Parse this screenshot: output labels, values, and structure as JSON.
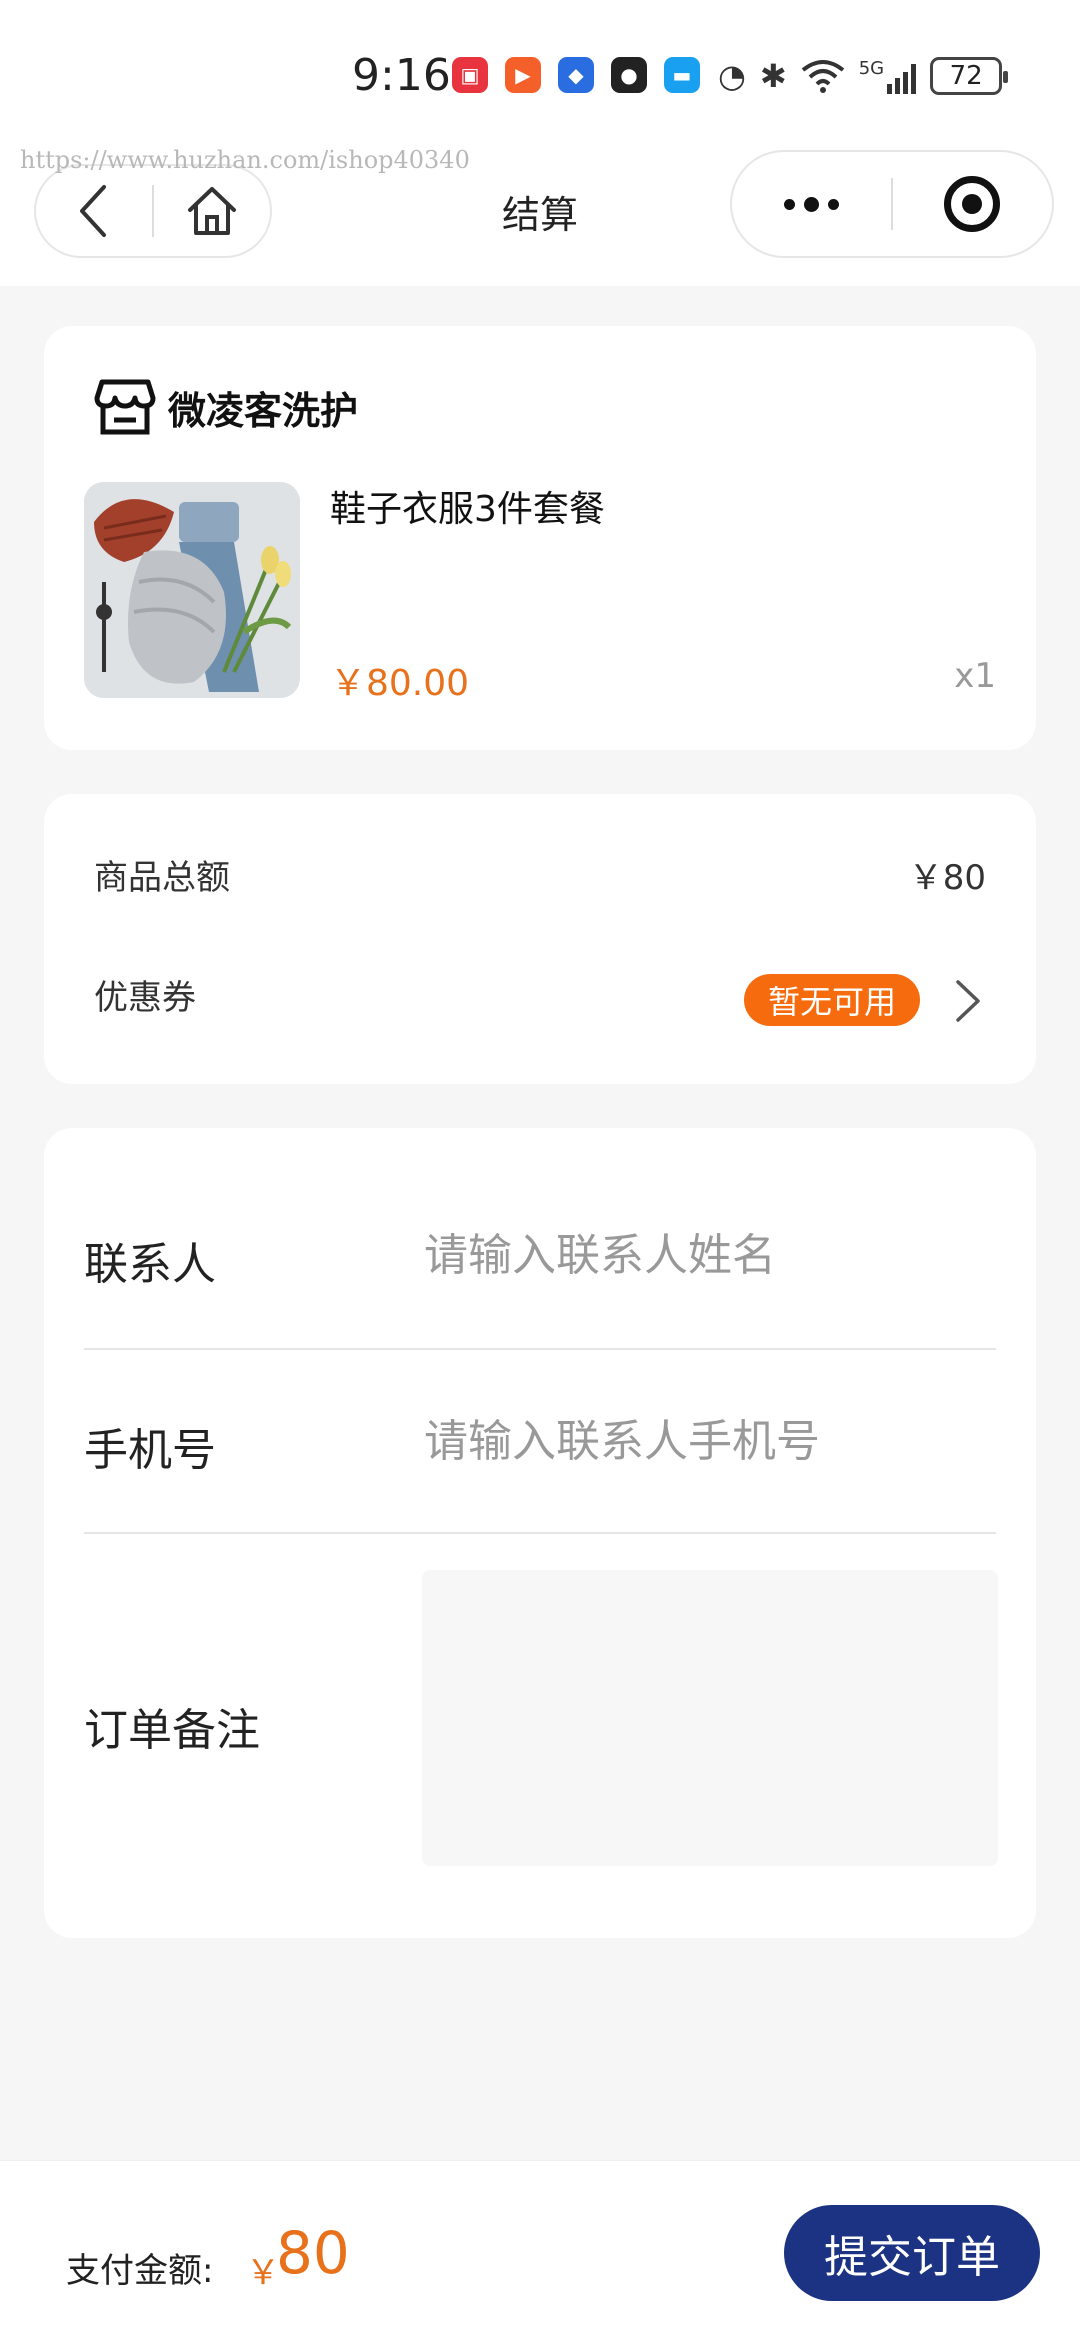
{
  "status_bar": {
    "time": "9:16",
    "network": "5G",
    "battery": "72",
    "apps": [
      {
        "name": "huawei-appgallery-icon",
        "color": "#e8343f",
        "glyph": "▣"
      },
      {
        "name": "kuaishou-icon",
        "color": "#f5602a",
        "glyph": "▶"
      },
      {
        "name": "app-blue-icon",
        "color": "#2a6de0",
        "glyph": "◆"
      },
      {
        "name": "qq-penguin-icon",
        "color": "#222222",
        "glyph": "●"
      },
      {
        "name": "message-bubble-icon",
        "color": "#1aa0f0",
        "glyph": "▬"
      }
    ]
  },
  "watermark": "https://www.huzhan.com/ishop40340",
  "nav": {
    "title": "结算"
  },
  "shop": {
    "name": "微凌客洗护"
  },
  "product": {
    "name": "鞋子衣服3件套餐",
    "price": "￥80.00",
    "qty": "x1"
  },
  "summary": {
    "total_label": "商品总额",
    "total_value": "￥80",
    "coupon_label": "优惠券",
    "coupon_badge": "暂无可用"
  },
  "form": {
    "contact_label": "联系人",
    "contact_placeholder": "请输入联系人姓名",
    "phone_label": "手机号",
    "phone_placeholder": "请输入联系人手机号",
    "note_label": "订单备注"
  },
  "footer": {
    "pay_label": "支付金额:",
    "currency": "￥",
    "amount": "80",
    "submit": "提交订单"
  },
  "colors": {
    "accent_orange": "#e8711c",
    "badge_orange": "#f56b0d",
    "submit_blue": "#1c3383"
  }
}
